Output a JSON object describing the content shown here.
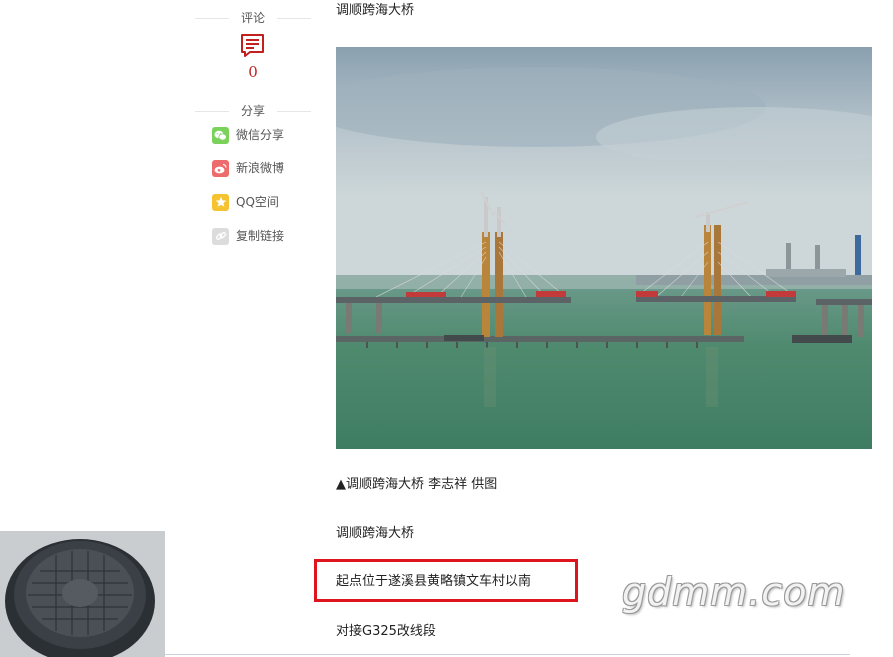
{
  "sidebar": {
    "comment": {
      "title": "评论",
      "count": "0",
      "icon": "comment-icon"
    },
    "share": {
      "title": "分享",
      "items": [
        {
          "label": "微信分享",
          "icon": "wechat-icon",
          "color": "#7bd25b"
        },
        {
          "label": "新浪微博",
          "icon": "weibo-icon",
          "color": "#ee6b6b"
        },
        {
          "label": "QQ空间",
          "icon": "qzone-icon",
          "color": "#f5c330"
        },
        {
          "label": "复制链接",
          "icon": "link-icon",
          "color": "#cfcfcf"
        }
      ]
    }
  },
  "article": {
    "heading_line": "调顺跨海大桥",
    "photo_caption": "▲调顺跨海大桥 李志祥 供图",
    "para1": "调顺跨海大桥",
    "para2": "起点位于遂溪县黄略镇文车村以南",
    "para3": "对接G325改线段"
  },
  "watermark": "gdmm.com",
  "colors": {
    "accent_red": "#c21f1f",
    "highlight_border": "#e0141e"
  }
}
